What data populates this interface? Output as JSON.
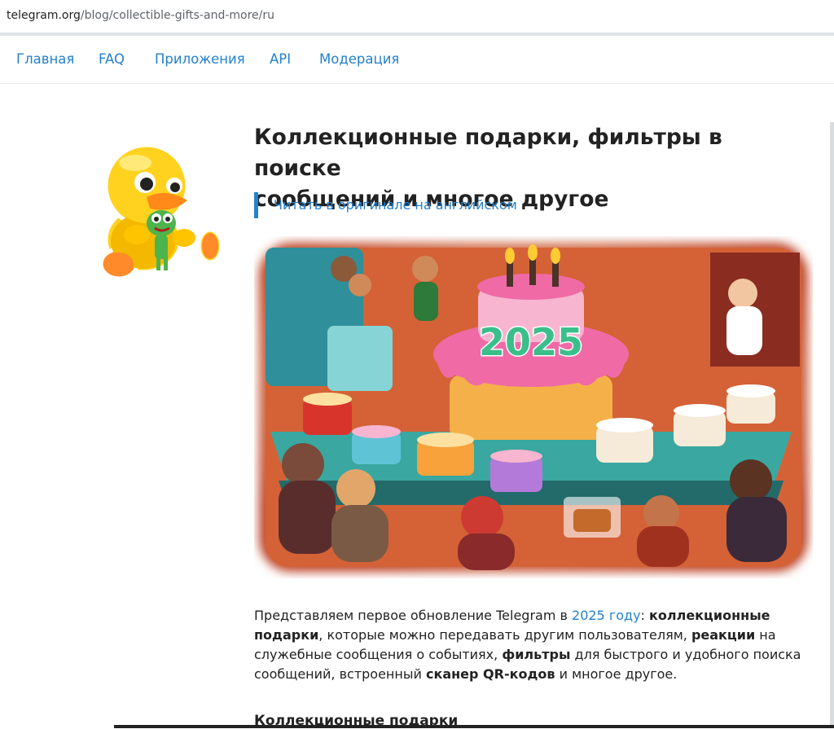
{
  "browser": {
    "url_host": "telegram.org",
    "url_path": "/blog/collectible-gifts-and-more/ru"
  },
  "nav": {
    "items": [
      "Главная",
      "FAQ",
      "Приложения",
      "API",
      "Модерация"
    ]
  },
  "article": {
    "title_line1": "Коллекционные подарки, фильтры в поиске",
    "title_line2": "сообщений и многое другое",
    "original_link": "Читать в оригинале на английском",
    "hero_cake_text": "2025",
    "intro": {
      "t1": "Представляем первое обновление Telegram в ",
      "link": "2025 году",
      "t2": ": ",
      "b1": "коллекционные подарки",
      "t3": ", которые можно передавать другим пользователям, ",
      "b2": "реакции",
      "t4": " на служебные сообщения о событиях, ",
      "b3": "фильтры",
      "t5": " для быстрого и удобного поиска сообщений, встроенный ",
      "b4": "сканер QR-кодов",
      "t6": " и многое другое."
    },
    "section_heading": "Коллекционные подарки"
  },
  "colors": {
    "link": "#2481cc",
    "text": "#222222",
    "duck_yellow": "#ffd21f",
    "cake_pink": "#f06aa6"
  }
}
